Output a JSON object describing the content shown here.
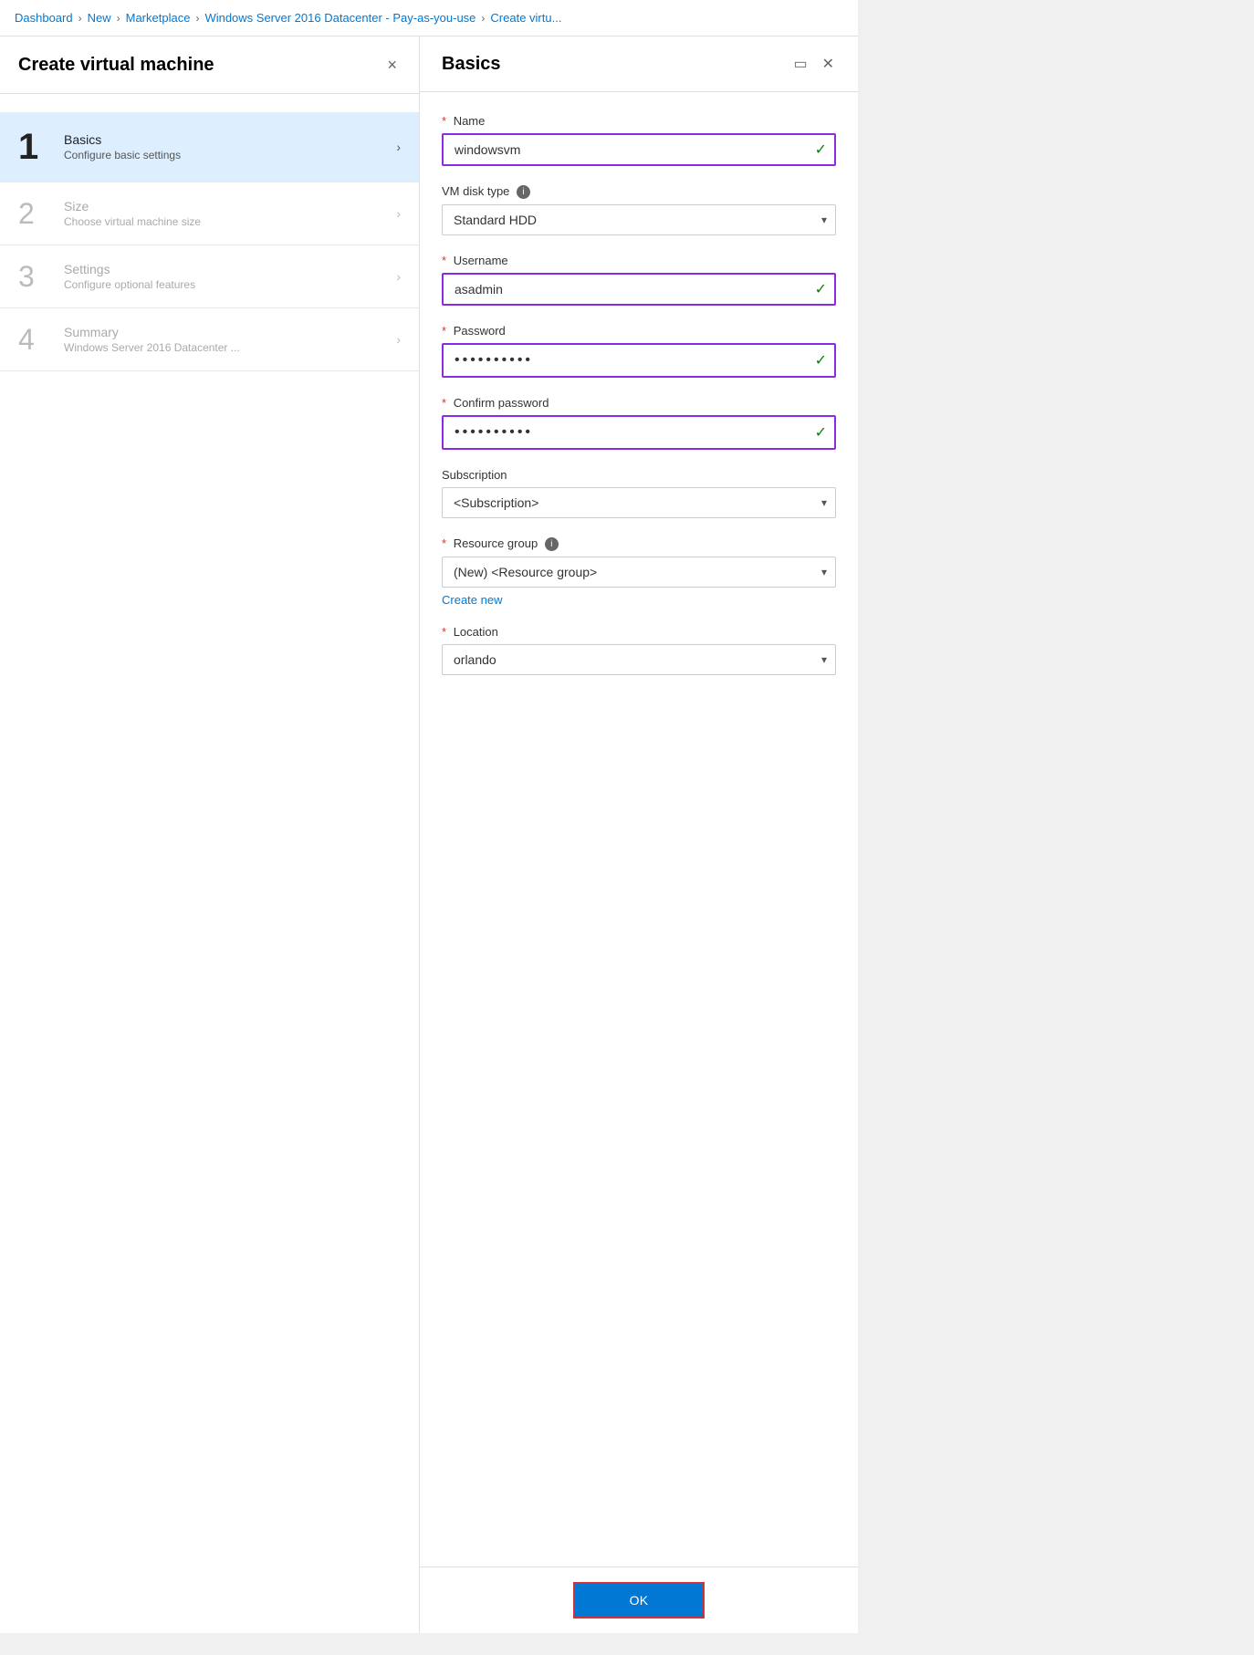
{
  "breadcrumb": {
    "items": [
      "Dashboard",
      "New",
      "Marketplace",
      "Windows Server 2016 Datacenter - Pay-as-you-use",
      "Create virtu..."
    ]
  },
  "left_panel": {
    "title": "Create virtual machine",
    "close_label": "×",
    "steps": [
      {
        "number": "1",
        "title": "Basics",
        "subtitle": "Configure basic settings",
        "active": true
      },
      {
        "number": "2",
        "title": "Size",
        "subtitle": "Choose virtual machine size",
        "active": false
      },
      {
        "number": "3",
        "title": "Settings",
        "subtitle": "Configure optional features",
        "active": false
      },
      {
        "number": "4",
        "title": "Summary",
        "subtitle": "Windows Server 2016 Datacenter ...",
        "active": false
      }
    ]
  },
  "right_panel": {
    "title": "Basics",
    "fields": {
      "name": {
        "label": "Name",
        "required": true,
        "value": "windowsvm",
        "has_check": true
      },
      "vm_disk_type": {
        "label": "VM disk type",
        "has_info": true,
        "value": "Standard HDD"
      },
      "username": {
        "label": "Username",
        "required": true,
        "value": "asadmin",
        "has_check": true
      },
      "password": {
        "label": "Password",
        "required": true,
        "value": "••••••••••",
        "has_check": true
      },
      "confirm_password": {
        "label": "Confirm password",
        "required": true,
        "value": "••••••••••",
        "has_check": true
      },
      "subscription": {
        "label": "Subscription",
        "value": "<Subscription>"
      },
      "resource_group": {
        "label": "Resource group",
        "required": true,
        "has_info": true,
        "value": "(New)  <Resource group>",
        "create_new_label": "Create new"
      },
      "location": {
        "label": "Location",
        "required": true,
        "value": "orlando"
      }
    },
    "ok_button": "OK"
  }
}
